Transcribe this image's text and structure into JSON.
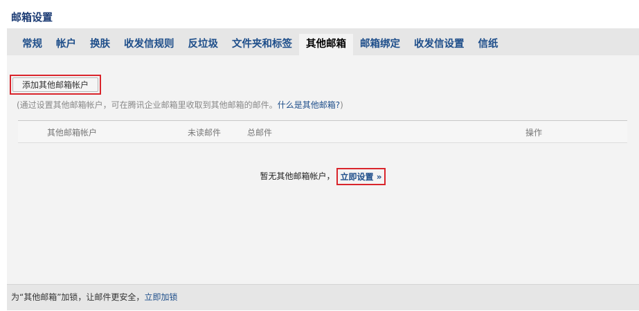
{
  "page": {
    "title": "邮箱设置"
  },
  "tabs": [
    {
      "label": "常规",
      "active": false
    },
    {
      "label": "帐户",
      "active": false
    },
    {
      "label": "换肤",
      "active": false
    },
    {
      "label": "收发信规则",
      "active": false
    },
    {
      "label": "反垃圾",
      "active": false
    },
    {
      "label": "文件夹和标签",
      "active": false
    },
    {
      "label": "其他邮箱",
      "active": true
    },
    {
      "label": "邮箱绑定",
      "active": false
    },
    {
      "label": "收发信设置",
      "active": false
    },
    {
      "label": "信纸",
      "active": false
    }
  ],
  "main": {
    "add_button_label": "添加其他邮箱帐户",
    "hint_prefix": "(通过设置其他邮箱帐户，可在腾讯企业邮箱里收取到其他邮箱的邮件。",
    "hint_link": "什么是其他邮箱?",
    "hint_suffix": ")",
    "table_headers": {
      "account": "其他邮箱帐户",
      "unread": "未读邮件",
      "total": "总邮件",
      "action": "操作"
    },
    "empty_text": "暂无其他邮箱帐户，",
    "setup_link": "立即设置 »"
  },
  "footer": {
    "text": "为“其他邮箱”加锁，让邮件更安全，",
    "lock_link": "立即加锁"
  },
  "colors": {
    "link": "#1e4e8a",
    "highlight_border": "#d9242b",
    "tab_bar": "#e6e6e6",
    "content_bg": "#f3f3f3"
  }
}
